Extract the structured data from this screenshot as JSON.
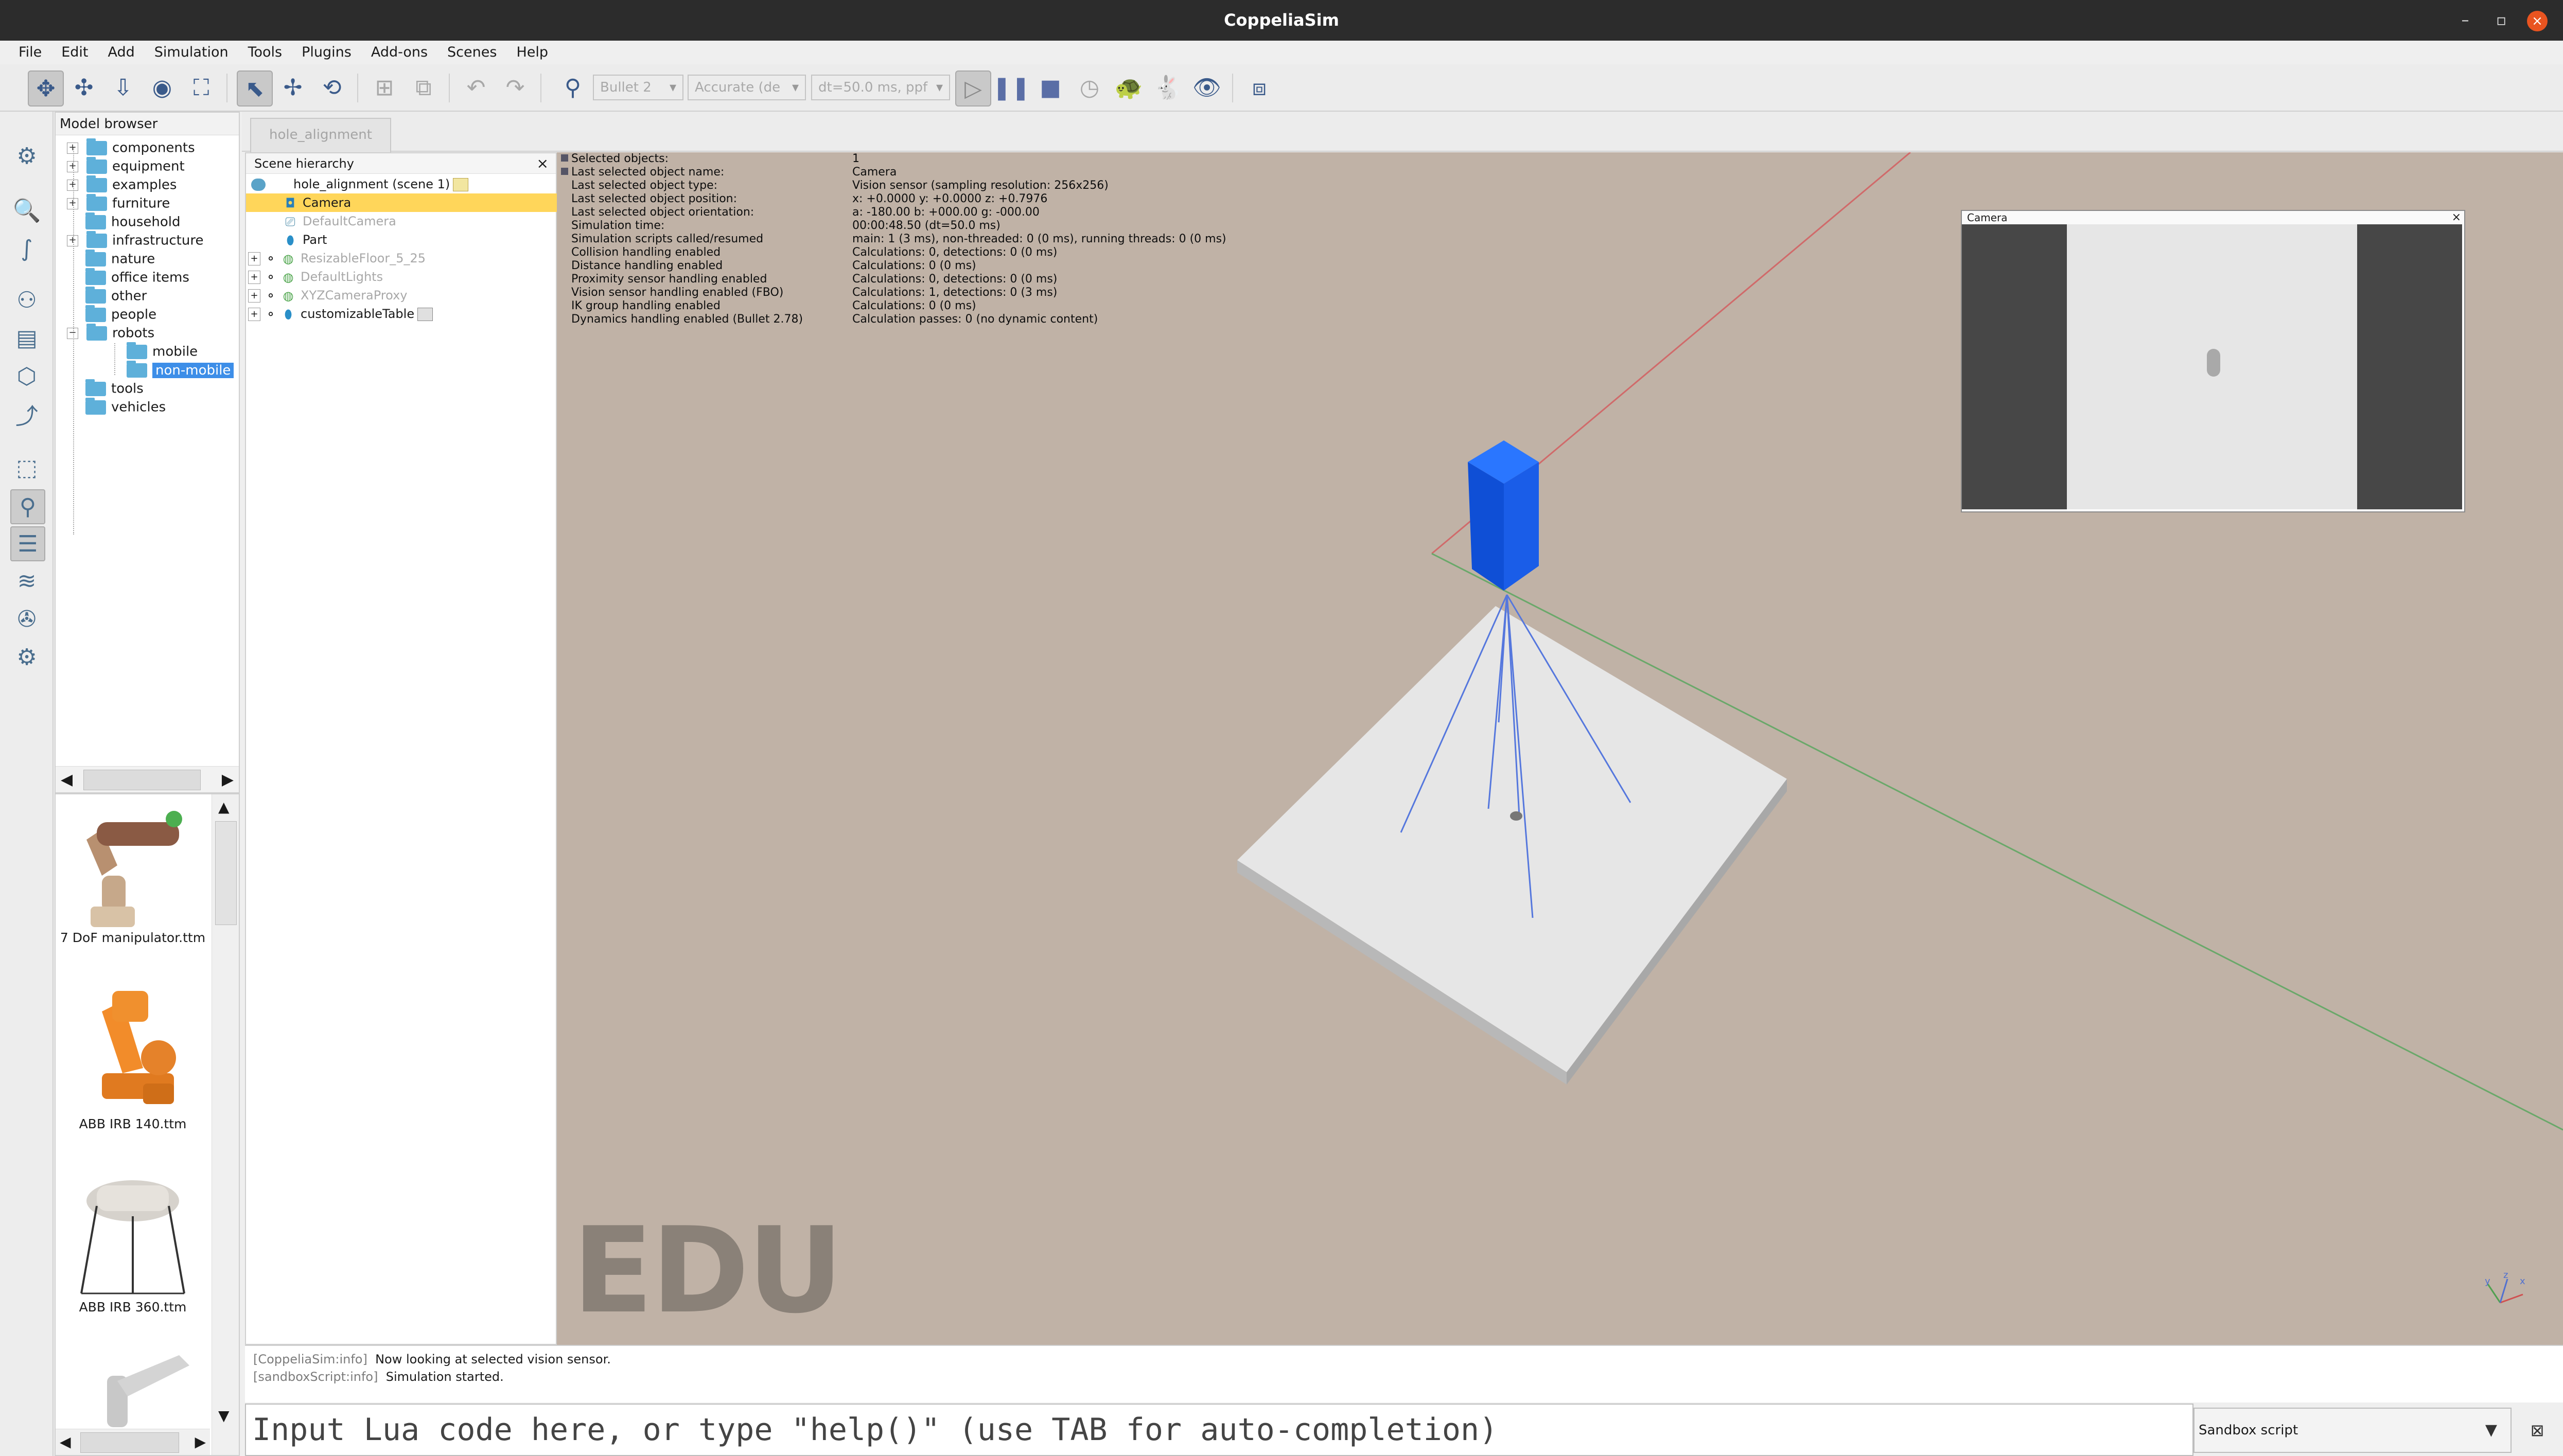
{
  "window": {
    "title": "CoppeliaSim",
    "minimize_label": "–",
    "maximize_label": "▫",
    "close_label": "×"
  },
  "menu": [
    "File",
    "Edit",
    "Add",
    "Simulation",
    "Tools",
    "Plugins",
    "Add-ons",
    "Scenes",
    "Help"
  ],
  "toolbar": {
    "engine": "Bullet 2",
    "accuracy": "Accurate (de",
    "timestep": "dt=50.0 ms, ppf",
    "icons": [
      "camera-pan-icon",
      "camera-rotate-icon",
      "camera-shift-icon",
      "camera-angle-icon",
      "fit-to-view-icon",
      "click-select-icon",
      "object-shift-icon",
      "object-rotate-icon",
      "assemble-icon",
      "transfer-dna-icon",
      "undo-icon",
      "redo-icon",
      "physics-engine-icon",
      "play-icon",
      "pause-icon",
      "stop-icon",
      "realtime-icon",
      "slow-down-icon",
      "speed-up-icon",
      "visualization-icon",
      "page-selector-icon"
    ]
  },
  "model_browser": {
    "title": "Model browser",
    "items": [
      {
        "label": "components",
        "expandable": true
      },
      {
        "label": "equipment",
        "expandable": true
      },
      {
        "label": "examples",
        "expandable": true
      },
      {
        "label": "furniture",
        "expandable": true
      },
      {
        "label": "household",
        "expandable": false
      },
      {
        "label": "infrastructure",
        "expandable": true
      },
      {
        "label": "nature",
        "expandable": false
      },
      {
        "label": "office items",
        "expandable": false
      },
      {
        "label": "other",
        "expandable": false
      },
      {
        "label": "people",
        "expandable": false
      },
      {
        "label": "robots",
        "expandable": true,
        "expanded": true
      },
      {
        "label": "mobile",
        "child": true
      },
      {
        "label": "non-mobile",
        "child": true,
        "selected": true
      },
      {
        "label": "tools",
        "expandable": false
      },
      {
        "label": "vehicles",
        "expandable": false
      }
    ],
    "thumbnails": [
      "7 DoF manipulator.ttm",
      "ABB IRB 140.ttm",
      "ABB IRB 360.ttm"
    ]
  },
  "scene_tab": "hole_alignment",
  "hierarchy": {
    "title": "Scene hierarchy",
    "close": "×",
    "rows": [
      {
        "label": "hole_alignment (scene 1)",
        "icon": "scene-icon"
      },
      {
        "label": "Camera",
        "icon": "vision-sensor-icon",
        "selected": true
      },
      {
        "label": "DefaultCamera",
        "icon": "camera-icon",
        "gray": true
      },
      {
        "label": "Part",
        "icon": "shape-icon"
      },
      {
        "label": "ResizableFloor_5_25",
        "icon": "floor-icon",
        "gray": true
      },
      {
        "label": "DefaultLights",
        "icon": "lights-icon",
        "gray": true
      },
      {
        "label": "XYZCameraProxy",
        "icon": "dummy-icon",
        "gray": true
      },
      {
        "label": "customizableTable",
        "icon": "shape-icon"
      }
    ]
  },
  "info": [
    {
      "label": "Selected objects:",
      "value": "1"
    },
    {
      "label": "Last selected object name:",
      "value": "Camera"
    },
    {
      "label": "Last selected object type:",
      "value": "Vision sensor (sampling resolution: 256x256)"
    },
    {
      "label": "Last selected object position:",
      "value": "x: +0.0000    y: +0.0000    z: +0.7976"
    },
    {
      "label": "Last selected object orientation:",
      "value": "a: -180.00    b: +000.00    g: -000.00"
    },
    {
      "label": "Simulation time:",
      "value": "00:00:48.50 (dt=50.0 ms)"
    },
    {
      "label": "Simulation scripts called/resumed",
      "value": "main: 1 (3 ms), non-threaded: 0 (0 ms), running threads: 0 (0 ms)"
    },
    {
      "label": "Collision handling enabled",
      "value": "Calculations: 0, detections: 0 (0 ms)"
    },
    {
      "label": "Distance handling enabled",
      "value": "Calculations: 0 (0 ms)"
    },
    {
      "label": "Proximity sensor handling enabled",
      "value": "Calculations: 0, detections: 0 (0 ms)"
    },
    {
      "label": "Vision sensor handling enabled (FBO)",
      "value": "Calculations: 1, detections: 0 (3 ms)"
    },
    {
      "label": "IK group handling enabled",
      "value": "Calculations: 0 (0 ms)"
    },
    {
      "label": "Dynamics handling enabled (Bullet 2.78)",
      "value": "Calculation passes: 0 (no dynamic content)"
    }
  ],
  "camera_window": {
    "title": "Camera",
    "close": "×"
  },
  "watermark": "EDU",
  "axes_labels": {
    "x": "x",
    "y": "y",
    "z": "z"
  },
  "console": [
    {
      "tag": "[CoppeliaSim:info]",
      "text": "Now looking at selected vision sensor."
    },
    {
      "tag": "[sandboxScript:info]",
      "text": "Simulation started."
    }
  ],
  "lua_input": {
    "placeholder": "Input Lua code here, or type \"help()\" (use TAB for auto-completion)"
  },
  "script_selector": "Sandbox script",
  "colors": {
    "viewport_bg": "#c0b2a6",
    "sensor_blue": "#1560e0",
    "selection_yellow": "#ffd65a",
    "selection_blue": "#3d8ee8",
    "close_orange": "#e95420"
  }
}
